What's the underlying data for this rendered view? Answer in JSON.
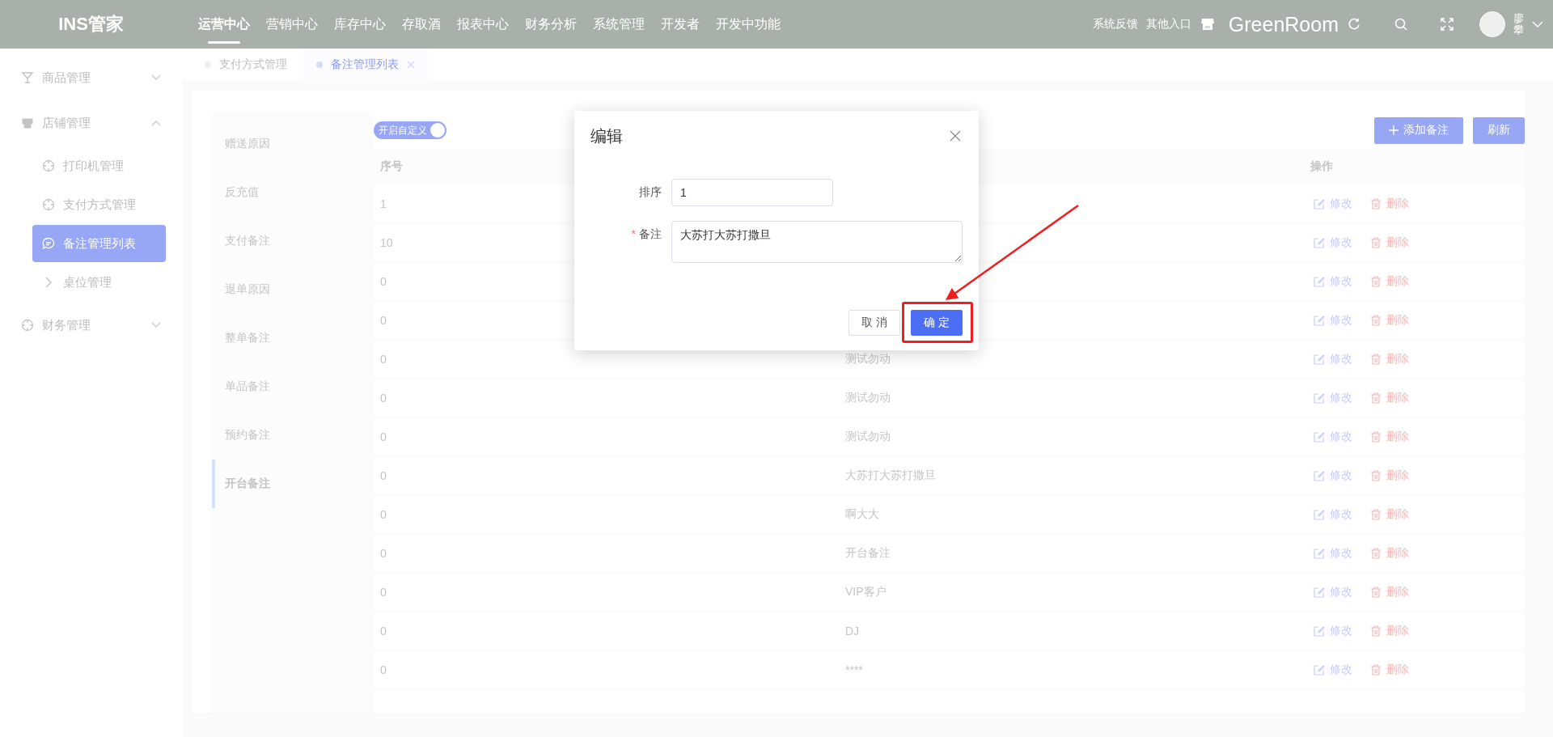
{
  "topbar": {
    "logo": "INS管家",
    "nav": [
      {
        "label": "运营中心",
        "selected": true
      },
      {
        "label": "营销中心",
        "selected": false
      },
      {
        "label": "库存中心",
        "selected": false
      },
      {
        "label": "存取酒",
        "selected": false
      },
      {
        "label": "报表中心",
        "selected": false
      },
      {
        "label": "财务分析",
        "selected": false
      },
      {
        "label": "系统管理",
        "selected": false
      },
      {
        "label": "开发者",
        "selected": false
      },
      {
        "label": "开发中功能",
        "selected": false
      }
    ],
    "links": [
      "系统反馈",
      "其他入口"
    ],
    "store": "GreenRoom",
    "user": "廖攀"
  },
  "sidebar": {
    "items": [
      {
        "label": "商品管理",
        "expanded": false
      },
      {
        "label": "店铺管理",
        "expanded": true,
        "children": [
          {
            "label": "打印机管理",
            "selected": false
          },
          {
            "label": "支付方式管理",
            "selected": false
          },
          {
            "label": "备注管理列表",
            "selected": true
          },
          {
            "label": "桌位管理",
            "selected": false
          }
        ]
      },
      {
        "label": "财务管理",
        "expanded": false
      }
    ]
  },
  "tabs": [
    {
      "label": "支付方式管理",
      "selected": false
    },
    {
      "label": "备注管理列表",
      "selected": true
    }
  ],
  "categories": [
    {
      "label": "赠送原因",
      "selected": false
    },
    {
      "label": "反充值",
      "selected": false
    },
    {
      "label": "支付备注",
      "selected": false
    },
    {
      "label": "退单原因",
      "selected": false
    },
    {
      "label": "整单备注",
      "selected": false
    },
    {
      "label": "单品备注",
      "selected": false
    },
    {
      "label": "预约备注",
      "selected": false
    },
    {
      "label": "开台备注",
      "selected": true
    }
  ],
  "toggle": {
    "label": "开启自定义",
    "on": true
  },
  "toolbar": {
    "add": "添加备注",
    "refresh": "刷新"
  },
  "table": {
    "header": {
      "column_1": "序号",
      "column_3": "操作"
    },
    "rows": [
      {
        "column_1": "1",
        "edit": "修改",
        "delete": "删除"
      },
      {
        "column_1": "10",
        "edit": "修改",
        "delete": "删除"
      },
      {
        "column_1": "0",
        "edit": "修改",
        "delete": "删除"
      },
      {
        "column_1": "0",
        "edit": "修改",
        "delete": "删除"
      },
      {
        "column_1": "0",
        "column_2": "测试勿动",
        "edit": "修改",
        "delete": "删除"
      },
      {
        "column_1": "0",
        "column_2": "测试勿动",
        "edit": "修改",
        "delete": "删除"
      },
      {
        "column_1": "0",
        "column_2": "测试勿动",
        "edit": "修改",
        "delete": "删除"
      },
      {
        "column_1": "0",
        "column_2": "大苏打大苏打撒旦",
        "edit": "修改",
        "delete": "删除"
      },
      {
        "column_1": "0",
        "column_2": "啊大大",
        "edit": "修改",
        "delete": "删除"
      },
      {
        "column_1": "0",
        "column_2": "开台备注",
        "edit": "修改",
        "delete": "删除"
      },
      {
        "column_1": "0",
        "column_2": "VIP客户",
        "edit": "修改",
        "delete": "删除"
      },
      {
        "column_1": "0",
        "column_2": "DJ",
        "edit": "修改",
        "delete": "删除"
      },
      {
        "column_1": "0",
        "column_2": "****",
        "edit": "修改",
        "delete": "删除"
      }
    ]
  },
  "modal": {
    "title": "编辑",
    "fields": [
      {
        "label": "排序",
        "kind": "input",
        "value": "1"
      },
      {
        "label": "备注",
        "kind": "textarea",
        "required_mark": "*",
        "value": "大苏打大苏打撒旦"
      }
    ],
    "buttons": [
      {
        "label": "取 消",
        "kind": "default"
      },
      {
        "label": "确 定",
        "kind": "primary",
        "highlighted": true
      }
    ]
  }
}
